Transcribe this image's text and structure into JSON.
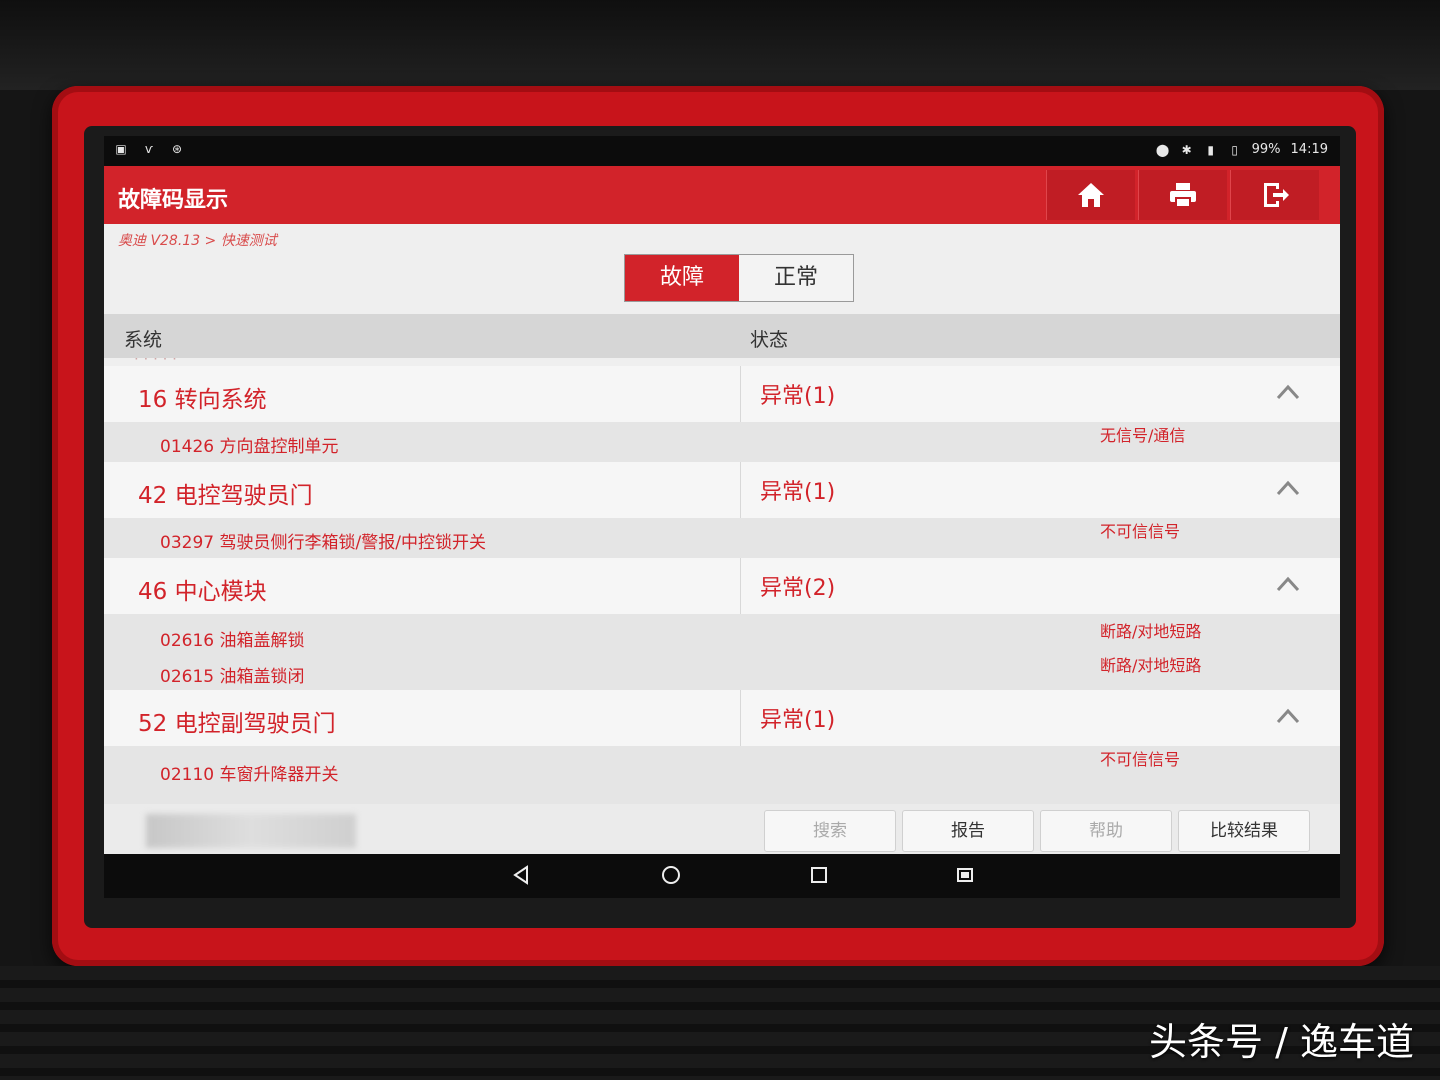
{
  "status_bar": {
    "battery": "99%",
    "time": "14:19"
  },
  "header": {
    "title": "故障码显示"
  },
  "breadcrumb": "奥迪 V28.13 > 快速测试",
  "tabs": [
    {
      "label": "故障",
      "active": true
    },
    {
      "label": "正常",
      "active": false
    }
  ],
  "columns": {
    "system": "系统",
    "status": "状态"
  },
  "systems": [
    {
      "name": "16 转向系统",
      "status": "异常(1)",
      "codes": [
        {
          "code": "01426 方向盘控制单元",
          "desc": "无信号/通信"
        }
      ]
    },
    {
      "name": "42 电控驾驶员门",
      "status": "异常(1)",
      "codes": [
        {
          "code": "03297 驾驶员侧行李箱锁/警报/中控锁开关",
          "desc": "不可信信号"
        }
      ]
    },
    {
      "name": "46 中心模块",
      "status": "异常(2)",
      "codes": [
        {
          "code": "02616 油箱盖解锁",
          "desc": "断路/对地短路"
        },
        {
          "code": "02615 油箱盖锁闭",
          "desc": "断路/对地短路"
        }
      ]
    },
    {
      "name": "52 电控副驾驶员门",
      "status": "异常(1)",
      "codes": [
        {
          "code": "02110 车窗升降器开关",
          "desc": "不可信信号"
        }
      ]
    }
  ],
  "buttons": {
    "search": "搜索",
    "report": "报告",
    "help": "帮助",
    "compare": "比较结果"
  },
  "watermark": "头条号 / 逸车道",
  "colors": {
    "accent": "#d2232a",
    "bezel": "#c8141b"
  }
}
